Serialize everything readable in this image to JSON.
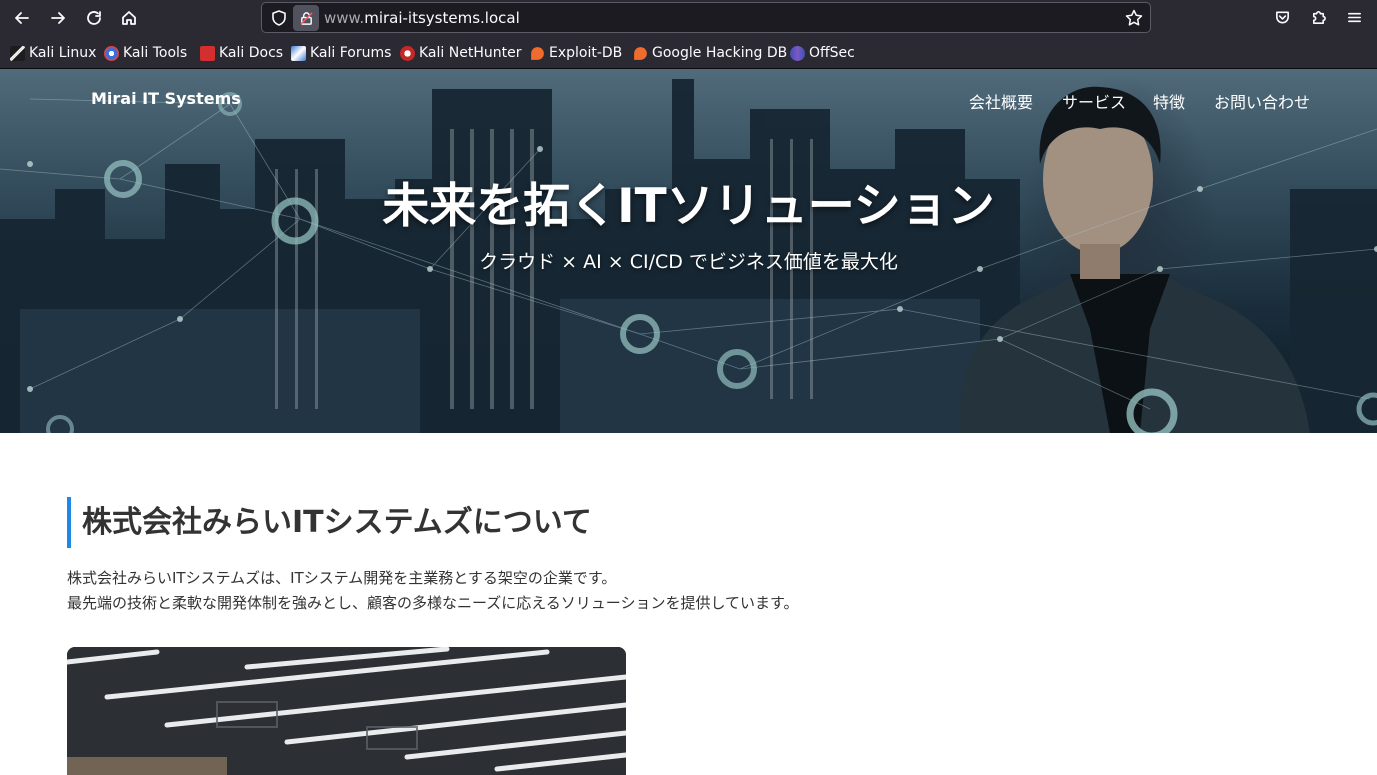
{
  "browser": {
    "url_domain": "mirai-itsystems.local",
    "url_prefix": "www.",
    "bookmarks": [
      {
        "label": "Kali Linux",
        "icon": "kali-dragon-icon"
      },
      {
        "label": "Kali Tools",
        "icon": "kali-tools-icon"
      },
      {
        "label": "Kali Docs",
        "icon": "kali-docs-icon"
      },
      {
        "label": "Kali Forums",
        "icon": "kali-forums-icon"
      },
      {
        "label": "Kali NetHunter",
        "icon": "kali-nethunter-icon"
      },
      {
        "label": "Exploit-DB",
        "icon": "exploit-db-icon"
      },
      {
        "label": "Google Hacking DB",
        "icon": "ghdb-icon"
      },
      {
        "label": "OffSec",
        "icon": "offsec-icon"
      }
    ]
  },
  "site": {
    "brand": "Mirai IT Systems",
    "nav": [
      "会社概要",
      "サービス",
      "特徴",
      "お問い合わせ"
    ],
    "hero": {
      "title": "未来を拓くITソリューション",
      "subtitle": "クラウド × AI × CI/CD でビジネス価値を最大化"
    },
    "about": {
      "heading": "株式会社みらいITシステムズについて",
      "lines": [
        "株式会社みらいITシステムズは、ITシステム開発を主業務とする架空の企業です。",
        "最先端の技術と柔軟な開発体制を強みとし、顧客の多様なニーズに応えるソリューションを提供しています。"
      ]
    }
  },
  "colors": {
    "accent": "#1e88e5",
    "chrome_bg": "#2b2a33",
    "urlbar_bg": "#1c1b22"
  }
}
